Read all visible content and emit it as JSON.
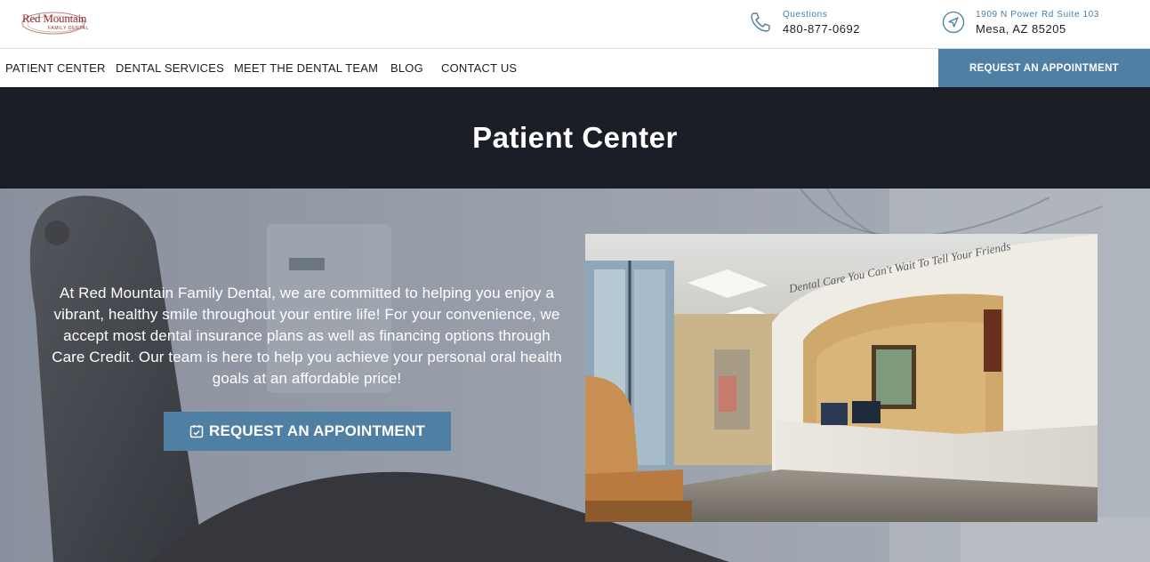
{
  "header": {
    "logo": {
      "line1": "Red Mountain",
      "line2": "FAMILY DENTAL"
    },
    "phone": {
      "label": "Questions",
      "value": "480-877-0692",
      "icon": "phone-icon"
    },
    "address": {
      "label": "1909 N Power Rd Suite 103",
      "value": "Mesa, AZ 85205",
      "icon": "location-arrow-icon"
    }
  },
  "nav": {
    "items": [
      {
        "label": "PATIENT CENTER"
      },
      {
        "label": "DENTAL SERVICES"
      },
      {
        "label": "MEET THE DENTAL TEAM"
      },
      {
        "label": "BLOG"
      },
      {
        "label": "CONTACT US"
      }
    ],
    "cta": "REQUEST AN APPOINTMENT"
  },
  "page": {
    "title": "Patient Center"
  },
  "hero": {
    "text": "At Red Mountain Family Dental, we are committed to helping you enjoy a vibrant, healthy smile throughout your entire life! For your convenience, we accept most dental insurance plans as well as financing options through Care Credit. Our team is here to help you achieve your personal oral health goals at an affordable price!",
    "cta": "REQUEST AN APPOINTMENT",
    "cta_icon": "calendar-check-icon",
    "photo_wall_text": "Dental Care You Can't Wait To Tell Your Friends"
  },
  "colors": {
    "accent": "#4f7fa3",
    "dark": "#1b1e27",
    "brand_red": "#8e2c2a",
    "link_blue": "#4a7ea5"
  }
}
